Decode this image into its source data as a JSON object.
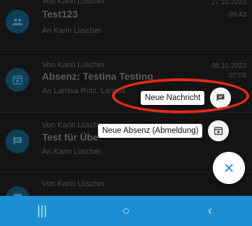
{
  "messages": [
    {
      "from": "Von Karin Lüscher",
      "subject": "Test123",
      "to": "An Karin Lüscher",
      "date": "27.10.2023",
      "time": "09:43",
      "icon": "group-icon"
    },
    {
      "from": "Von Karin Lüscher",
      "subject": "Absenz: Testina Testing",
      "to": "An Larissa Rutz, Larissa",
      "date": "08.10.2023",
      "time": "07:09",
      "icon": "calendar-x-icon"
    },
    {
      "from": "Von Karin Lüscher",
      "subject": "Test für Übe",
      "to": "An Karin Lüscher",
      "date": "",
      "time": "",
      "icon": "chat-icon"
    },
    {
      "from": "Von Karin Lüscher",
      "subject": "",
      "to": "",
      "date": "",
      "time": "",
      "icon": "chat-icon"
    }
  ],
  "fab_menu": {
    "new_message_label": "Neue Nachricht",
    "new_absence_label": "Neue Absenz (Abmeldung)",
    "close_icon": "close-icon"
  },
  "colors": {
    "accent": "#1b8fd2",
    "highlight": "#e02b1a",
    "avatar": "#0e3f57"
  },
  "nav": {
    "recents_glyph": "|||",
    "home_glyph": "○",
    "back_glyph": "‹"
  }
}
